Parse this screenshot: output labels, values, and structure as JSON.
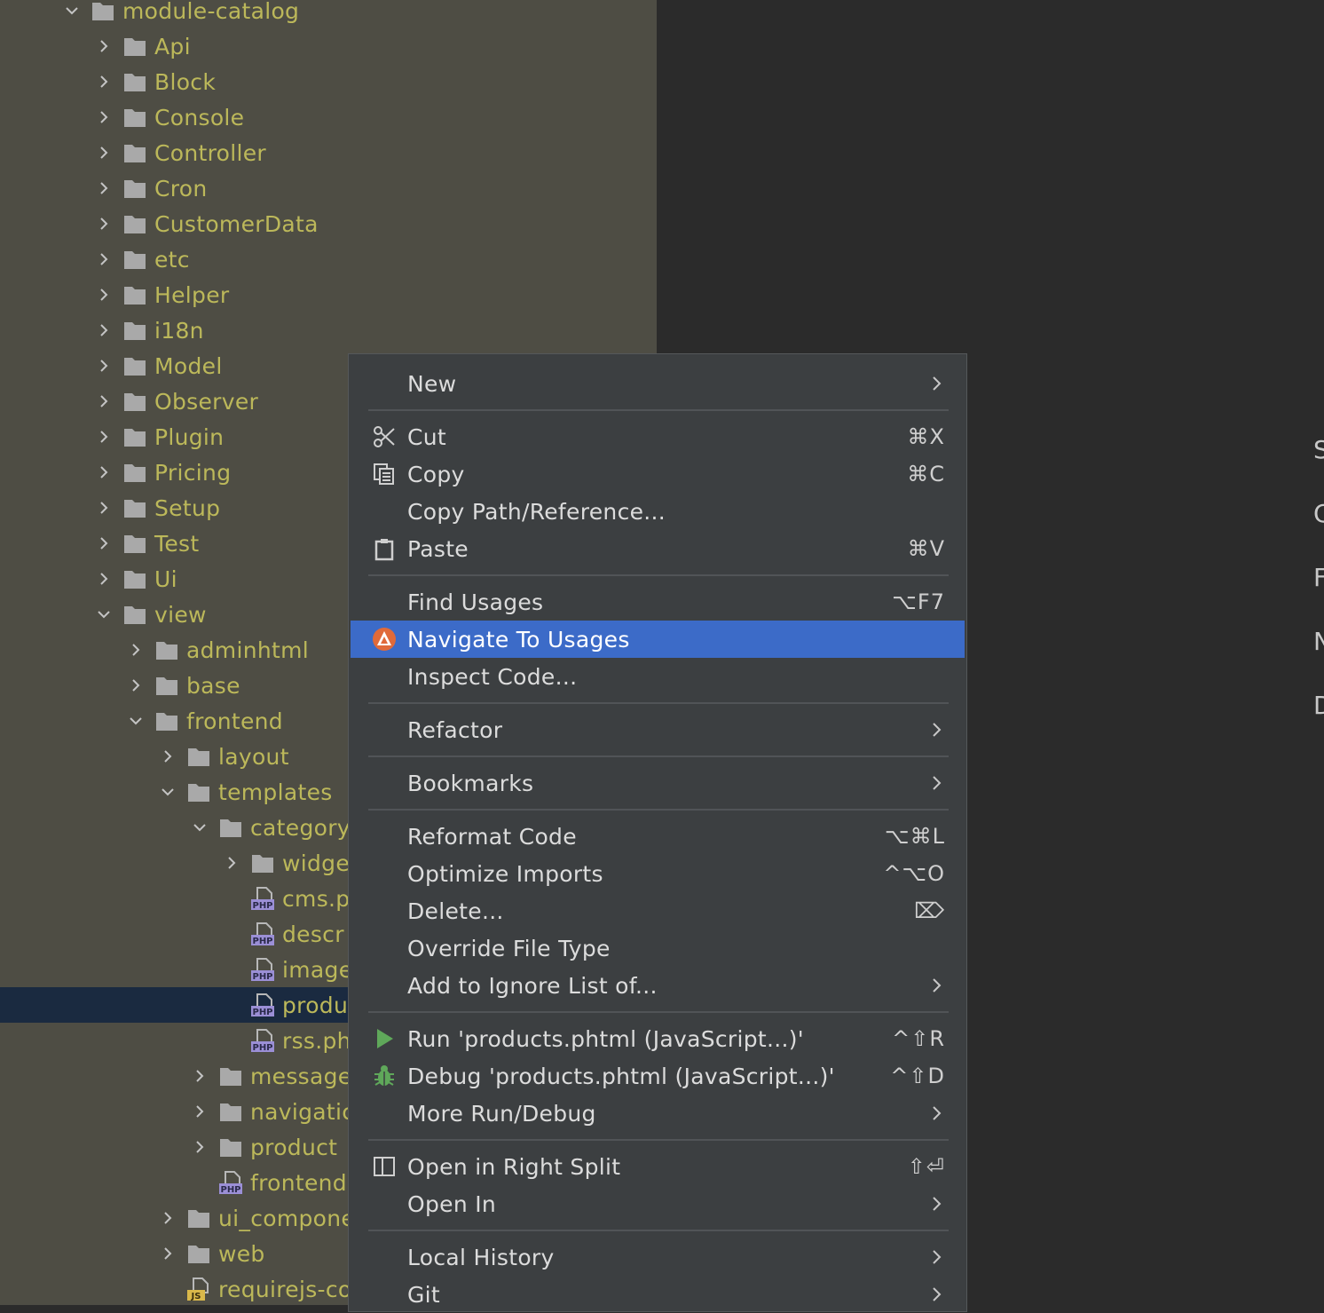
{
  "project_tree": {
    "items": [
      {
        "label": "module-catalog",
        "icon": "folder-icon",
        "expanded": true
      },
      {
        "label": "Api",
        "icon": "folder-icon",
        "expanded": false
      },
      {
        "label": "Block",
        "icon": "folder-icon",
        "expanded": false
      },
      {
        "label": "Console",
        "icon": "folder-icon",
        "expanded": false
      },
      {
        "label": "Controller",
        "icon": "folder-icon",
        "expanded": false
      },
      {
        "label": "Cron",
        "icon": "folder-icon",
        "expanded": false
      },
      {
        "label": "CustomerData",
        "icon": "folder-icon",
        "expanded": false
      },
      {
        "label": "etc",
        "icon": "folder-icon",
        "expanded": false
      },
      {
        "label": "Helper",
        "icon": "folder-icon",
        "expanded": false
      },
      {
        "label": "i18n",
        "icon": "folder-icon",
        "expanded": false
      },
      {
        "label": "Model",
        "icon": "folder-icon",
        "expanded": false
      },
      {
        "label": "Observer",
        "icon": "folder-icon",
        "expanded": false
      },
      {
        "label": "Plugin",
        "icon": "folder-icon",
        "expanded": false
      },
      {
        "label": "Pricing",
        "icon": "folder-icon",
        "expanded": false
      },
      {
        "label": "Setup",
        "icon": "folder-icon",
        "expanded": false
      },
      {
        "label": "Test",
        "icon": "folder-icon",
        "expanded": false
      },
      {
        "label": "Ui",
        "icon": "folder-icon",
        "expanded": false
      },
      {
        "label": "view",
        "icon": "folder-icon",
        "expanded": true
      },
      {
        "label": "adminhtml",
        "icon": "folder-icon",
        "expanded": false
      },
      {
        "label": "base",
        "icon": "folder-icon",
        "expanded": false
      },
      {
        "label": "frontend",
        "icon": "folder-icon",
        "expanded": true
      },
      {
        "label": "layout",
        "icon": "folder-icon",
        "expanded": false
      },
      {
        "label": "templates",
        "icon": "folder-icon",
        "expanded": true
      },
      {
        "label": "category",
        "icon": "folder-icon",
        "expanded": true
      },
      {
        "label": "widge",
        "icon": "folder-icon",
        "expanded": false
      },
      {
        "label": "cms.p",
        "icon": "php-file-icon"
      },
      {
        "label": "descr",
        "icon": "php-file-icon"
      },
      {
        "label": "image",
        "icon": "php-file-icon"
      },
      {
        "label": "produ",
        "icon": "php-file-icon",
        "selected": true
      },
      {
        "label": "rss.ph",
        "icon": "php-file-icon"
      },
      {
        "label": "message",
        "icon": "folder-icon",
        "expanded": false
      },
      {
        "label": "navigatic",
        "icon": "folder-icon",
        "expanded": false
      },
      {
        "label": "product",
        "icon": "folder-icon",
        "expanded": false
      },
      {
        "label": "frontend",
        "icon": "php-file-icon"
      },
      {
        "label": "ui_compone",
        "icon": "folder-icon",
        "expanded": false
      },
      {
        "label": "web",
        "icon": "folder-icon",
        "expanded": false
      },
      {
        "label": "requirejs-co",
        "icon": "js-file-icon"
      }
    ]
  },
  "context_menu": {
    "items": [
      {
        "label": "New",
        "submenu": true
      },
      {
        "label": "Cut",
        "shortcut": "⌘X",
        "icon": "scissors-icon"
      },
      {
        "label": "Copy",
        "shortcut": "⌘C",
        "icon": "copy-icon"
      },
      {
        "label": "Copy Path/Reference..."
      },
      {
        "label": "Paste",
        "shortcut": "⌘V",
        "icon": "paste-icon"
      },
      {
        "label": "Find Usages",
        "shortcut": "⌥F7"
      },
      {
        "label": "Navigate To Usages",
        "icon": "navigate-icon",
        "highlighted": true
      },
      {
        "label": "Inspect Code..."
      },
      {
        "label": "Refactor",
        "submenu": true
      },
      {
        "label": "Bookmarks",
        "submenu": true
      },
      {
        "label": "Reformat Code",
        "shortcut": "⌥⌘L"
      },
      {
        "label": "Optimize Imports",
        "shortcut": "^⌥O"
      },
      {
        "label": "Delete...",
        "shortcut": "⌦"
      },
      {
        "label": "Override File Type"
      },
      {
        "label": "Add to Ignore List of...",
        "submenu": true
      },
      {
        "label": "Run 'products.phtml (JavaScript...)'",
        "shortcut": "^⇧R",
        "icon": "run-icon"
      },
      {
        "label": "Debug 'products.phtml (JavaScript...)'",
        "shortcut": "^⇧D",
        "icon": "debug-icon"
      },
      {
        "label": "More Run/Debug",
        "submenu": true
      },
      {
        "label": "Open in Right Split",
        "shortcut": "⇧⏎",
        "icon": "split-icon"
      },
      {
        "label": "Open In",
        "submenu": true
      },
      {
        "label": "Local History",
        "submenu": true
      },
      {
        "label": "Git",
        "submenu": true
      }
    ]
  },
  "right_edge": {
    "letters": [
      "S",
      "C",
      "F",
      "N",
      "D"
    ]
  },
  "colors": {
    "tree_bg": "#4e4d44",
    "tree_text": "#bcb85a",
    "menu_bg": "#3c3f41",
    "highlight": "#3c6bc8",
    "selected_row": "#1a2a40",
    "editor_bg": "#2b2b2b"
  }
}
